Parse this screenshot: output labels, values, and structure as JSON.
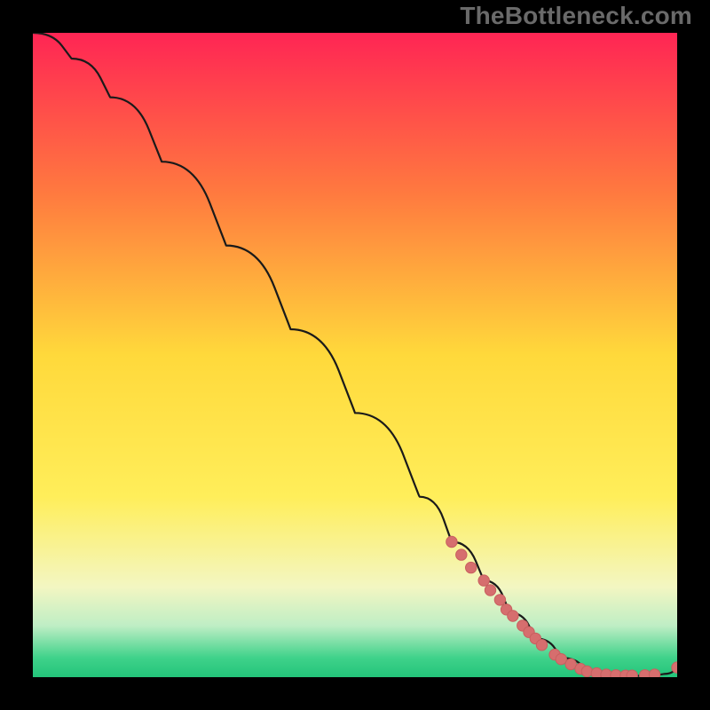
{
  "watermark": "TheBottleneck.com",
  "colors": {
    "background": "#000000",
    "curve_stroke": "#1a1a1a",
    "marker_fill": "#d66e6e",
    "marker_stroke": "#c85f5f",
    "watermark": "#6a6a6a",
    "gradient_stops": [
      {
        "offset": 0,
        "color": "#ff2554"
      },
      {
        "offset": 25,
        "color": "#ff7a3f"
      },
      {
        "offset": 50,
        "color": "#ffd93b"
      },
      {
        "offset": 72,
        "color": "#ffee5a"
      },
      {
        "offset": 86,
        "color": "#f3f6c2"
      },
      {
        "offset": 92,
        "color": "#bfeec5"
      },
      {
        "offset": 97,
        "color": "#3fd28a"
      },
      {
        "offset": 100,
        "color": "#23c47a"
      }
    ]
  },
  "chart_data": {
    "type": "line",
    "title": "",
    "xlabel": "",
    "ylabel": "",
    "xlim": [
      0,
      100
    ],
    "ylim": [
      0,
      100
    ],
    "series": [
      {
        "name": "bottleneck-curve",
        "x": [
          0,
          6,
          12,
          20,
          30,
          40,
          50,
          60,
          65,
          70,
          74,
          78,
          82,
          86,
          90,
          94,
          98,
          100
        ],
        "y": [
          100,
          96,
          90,
          80,
          67,
          54,
          41,
          28,
          21,
          15,
          10,
          6,
          3,
          1,
          0.3,
          0.2,
          0.5,
          1.5
        ]
      }
    ],
    "markers": [
      {
        "x": 65,
        "y": 21
      },
      {
        "x": 66.5,
        "y": 19
      },
      {
        "x": 68,
        "y": 17
      },
      {
        "x": 70,
        "y": 15
      },
      {
        "x": 71,
        "y": 13.5
      },
      {
        "x": 72.5,
        "y": 12
      },
      {
        "x": 73.5,
        "y": 10.5
      },
      {
        "x": 74.5,
        "y": 9.5
      },
      {
        "x": 76,
        "y": 8
      },
      {
        "x": 77,
        "y": 7
      },
      {
        "x": 78,
        "y": 6
      },
      {
        "x": 79,
        "y": 5
      },
      {
        "x": 81,
        "y": 3.5
      },
      {
        "x": 82,
        "y": 2.8
      },
      {
        "x": 83.5,
        "y": 2
      },
      {
        "x": 85,
        "y": 1.3
      },
      {
        "x": 86,
        "y": 0.9
      },
      {
        "x": 87.5,
        "y": 0.6
      },
      {
        "x": 89,
        "y": 0.4
      },
      {
        "x": 90.5,
        "y": 0.3
      },
      {
        "x": 92,
        "y": 0.25
      },
      {
        "x": 93,
        "y": 0.25
      },
      {
        "x": 95,
        "y": 0.3
      },
      {
        "x": 96.5,
        "y": 0.4
      },
      {
        "x": 100,
        "y": 1.5
      }
    ]
  }
}
